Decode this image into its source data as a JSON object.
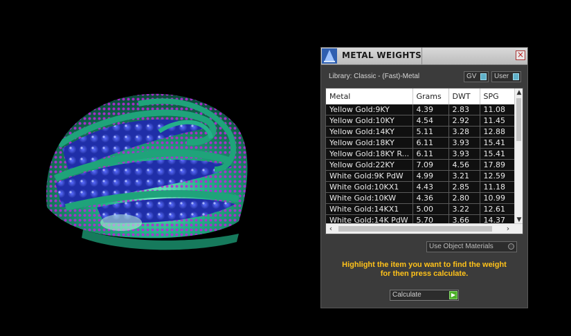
{
  "panel": {
    "title": "METAL WEIGHTS",
    "close_symbol": "×",
    "library_label": "Library: Classic - (Fast)-Metal",
    "gv_label": "GV",
    "user_label": "User",
    "use_object_materials": "Use Object Materials",
    "instructions_line1": "Highlight the item you want to find the weight",
    "instructions_line2": "for then press calculate.",
    "calculate_label": "Calculate"
  },
  "table": {
    "columns": [
      "Metal",
      "Grams",
      "DWT",
      "SPG"
    ],
    "rows": [
      [
        "Yellow Gold:9KY",
        "4.39",
        "2.83",
        "11.08"
      ],
      [
        "Yellow Gold:10KY",
        "4.54",
        "2.92",
        "11.45"
      ],
      [
        "Yellow Gold:14KY",
        "5.11",
        "3.28",
        "12.88"
      ],
      [
        "Yellow Gold:18KY",
        "6.11",
        "3.93",
        "15.41"
      ],
      [
        "Yellow Gold:18KY R...",
        "6.11",
        "3.93",
        "15.41"
      ],
      [
        "Yellow Gold:22KY",
        "7.09",
        "4.56",
        "17.89"
      ],
      [
        "White Gold:9K PdW",
        "4.99",
        "3.21",
        "12.59"
      ],
      [
        "White Gold:10KX1",
        "4.43",
        "2.85",
        "11.18"
      ],
      [
        "White Gold:10KW",
        "4.36",
        "2.80",
        "10.99"
      ],
      [
        "White Gold:14KX1",
        "5.00",
        "3.22",
        "12.61"
      ],
      [
        "White Gold:14K PdW",
        "5.70",
        "3.66",
        "14.37"
      ]
    ]
  },
  "icons": {
    "logo": "wizard-hat-logo-icon",
    "close": "close-icon",
    "scroll_up": "chevron-up-icon",
    "scroll_down": "chevron-down-icon",
    "scroll_left": "chevron-left-icon",
    "scroll_right": "chevron-right-icon",
    "calculate_go": "play-arrow-icon"
  },
  "colors": {
    "metal": "#1fa37a",
    "gem": "#2b3fc2",
    "bead": "#b42ad6",
    "instruction_text": "#ffc21a"
  }
}
